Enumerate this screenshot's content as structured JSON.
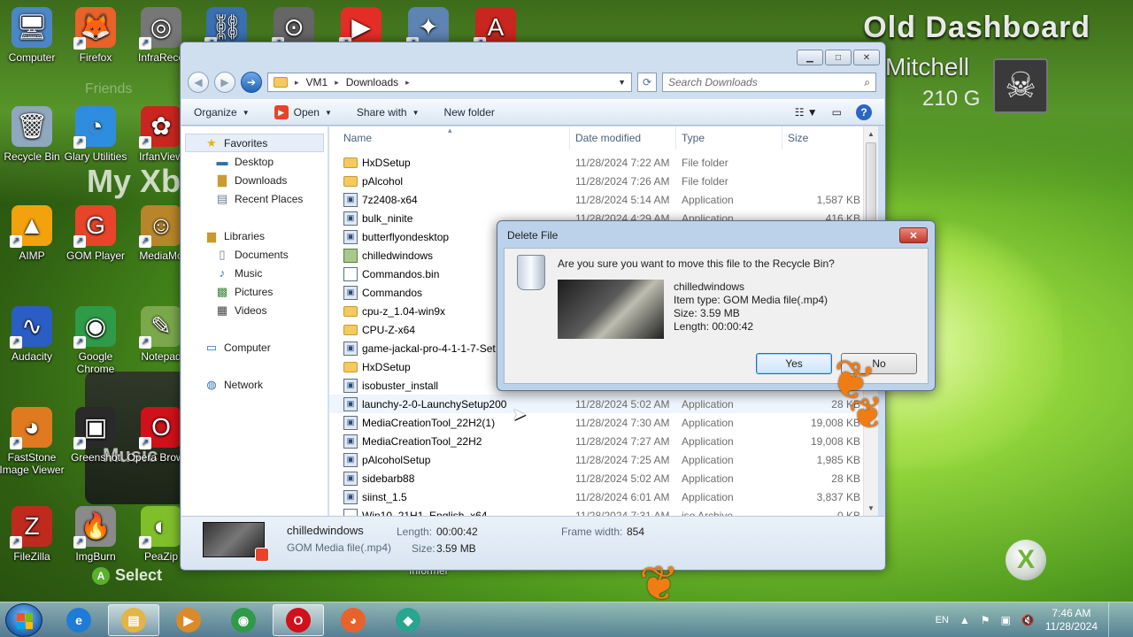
{
  "wallpaper": {
    "heading": "Old Dashboard",
    "gamer_name": "Mitchell",
    "gamer_score": "210 G",
    "faded_friends": "Friends",
    "faded_myx": "My Xb",
    "faded_music": "Music",
    "select_hint": "Select",
    "select_button": "A",
    "informer": "Informer"
  },
  "desktop_icons": [
    {
      "label": "Computer",
      "icon": "computer-icon",
      "glyph": "🖥",
      "color": "#4d86c6",
      "arrow": false
    },
    {
      "label": "Firefox",
      "icon": "firefox-icon",
      "glyph": "🦊",
      "color": "#e8622b",
      "arrow": true
    },
    {
      "label": "InfraReco",
      "icon": "infrarecorder-icon",
      "glyph": "◎",
      "color": "#777",
      "arrow": true
    },
    {
      "label": "",
      "icon": "network-tool-icon",
      "glyph": "⛓",
      "color": "#3a6fb0",
      "arrow": true
    },
    {
      "label": "",
      "icon": "disc-tool-icon",
      "glyph": "⊙",
      "color": "#666",
      "arrow": true
    },
    {
      "label": "",
      "icon": "youtube-icon",
      "glyph": "▶",
      "color": "#e52d27",
      "arrow": true
    },
    {
      "label": "",
      "icon": "satellite-icon",
      "glyph": "✦",
      "color": "#5d84b3",
      "arrow": true
    },
    {
      "label": "",
      "icon": "adobe-reader-icon",
      "glyph": "A",
      "color": "#c8261f",
      "arrow": true
    },
    {
      "label": "Recycle Bin",
      "icon": "recycle-bin-icon",
      "glyph": "🗑",
      "color": "#8fa7bf",
      "arrow": false
    },
    {
      "label": "Glary Utilities",
      "icon": "glary-utilities-icon",
      "glyph": "◔",
      "color": "#2f8de0",
      "arrow": true
    },
    {
      "label": "IrfanView",
      "icon": "irfanview-icon",
      "glyph": "✿",
      "color": "#c8261f",
      "arrow": true
    },
    {
      "label": "AIMP",
      "icon": "aimp-icon",
      "glyph": "▲",
      "color": "#f2a20c",
      "arrow": true
    },
    {
      "label": "GOM Player",
      "icon": "gom-player-icon",
      "glyph": "G",
      "color": "#e8442a",
      "arrow": true
    },
    {
      "label": "MediaMo",
      "icon": "mediamonkey-icon",
      "glyph": "☺",
      "color": "#b8862a",
      "arrow": true
    },
    {
      "label": "Audacity",
      "icon": "audacity-icon",
      "glyph": "∿",
      "color": "#2a5ec4",
      "arrow": true
    },
    {
      "label": "Google Chrome",
      "icon": "chrome-icon",
      "glyph": "◉",
      "color": "#2f9a48",
      "arrow": true
    },
    {
      "label": "Notepad",
      "icon": "notepad-icon",
      "glyph": "✎",
      "color": "#7aa84b",
      "arrow": true
    },
    {
      "label": "FastStone Image Viewer",
      "icon": "faststone-icon",
      "glyph": "◕",
      "color": "#e07a20",
      "arrow": true
    },
    {
      "label": "Greenshot",
      "icon": "greenshot-icon",
      "glyph": "▣",
      "color": "#2a2a2a",
      "arrow": true
    },
    {
      "label": "Opera Browse",
      "icon": "opera-icon",
      "glyph": "O",
      "color": "#d0101a",
      "arrow": true
    },
    {
      "label": "FileZilla",
      "icon": "filezilla-icon",
      "glyph": "Z",
      "color": "#bf2a1f",
      "arrow": true
    },
    {
      "label": "ImgBurn",
      "icon": "imgburn-icon",
      "glyph": "🔥",
      "color": "#8a8a8a",
      "arrow": true
    },
    {
      "label": "PeaZip",
      "icon": "peazip-icon",
      "glyph": "◐",
      "color": "#7fbf2a",
      "arrow": true
    }
  ],
  "explorer": {
    "address": {
      "crumbs": [
        "VM1",
        "Downloads"
      ]
    },
    "search_placeholder": "Search Downloads",
    "toolbar": {
      "organize": "Organize",
      "open": "Open",
      "share": "Share with",
      "new_folder": "New folder"
    },
    "nav": {
      "favorites": "Favorites",
      "desktop": "Desktop",
      "downloads": "Downloads",
      "recent": "Recent Places",
      "libraries": "Libraries",
      "documents": "Documents",
      "music": "Music",
      "pictures": "Pictures",
      "videos": "Videos",
      "computer": "Computer",
      "network": "Network"
    },
    "columns": {
      "name": "Name",
      "date": "Date modified",
      "type": "Type",
      "size": "Size"
    },
    "files": [
      {
        "name": "HxDSetup",
        "date": "11/28/2024 7:22 AM",
        "type": "File folder",
        "size": "",
        "kind": "folder"
      },
      {
        "name": "pAlcohol",
        "date": "11/28/2024 7:26 AM",
        "type": "File folder",
        "size": "",
        "kind": "folder"
      },
      {
        "name": "7z2408-x64",
        "date": "11/28/2024 5:14 AM",
        "type": "Application",
        "size": "1,587 KB",
        "kind": "app"
      },
      {
        "name": "bulk_ninite",
        "date": "11/28/2024 4:29 AM",
        "type": "Application",
        "size": "416 KB",
        "kind": "app"
      },
      {
        "name": "butterflyondesktop",
        "date": "",
        "type": "",
        "size": "",
        "kind": "app"
      },
      {
        "name": "chilledwindows",
        "date": "",
        "type": "",
        "size": "",
        "kind": "video"
      },
      {
        "name": "Commandos.bin",
        "date": "",
        "type": "",
        "size": "",
        "kind": "file"
      },
      {
        "name": "Commandos",
        "date": "",
        "type": "",
        "size": "",
        "kind": "app"
      },
      {
        "name": "cpu-z_1.04-win9x",
        "date": "",
        "type": "",
        "size": "",
        "kind": "folder"
      },
      {
        "name": "CPU-Z-x64",
        "date": "",
        "type": "",
        "size": "",
        "kind": "folder"
      },
      {
        "name": "game-jackal-pro-4-1-1-7-Set",
        "date": "",
        "type": "",
        "size": "",
        "kind": "app"
      },
      {
        "name": "HxDSetup",
        "date": "",
        "type": "",
        "size": "",
        "kind": "folder"
      },
      {
        "name": "isobuster_install",
        "date": "",
        "type": "",
        "size": "",
        "kind": "app"
      },
      {
        "name": "launchy-2-0-LaunchySetup200",
        "date": "11/28/2024 5:02 AM",
        "type": "Application",
        "size": "28 KB",
        "kind": "app"
      },
      {
        "name": "MediaCreationTool_22H2(1)",
        "date": "11/28/2024 7:30 AM",
        "type": "Application",
        "size": "19,008 KB",
        "kind": "app"
      },
      {
        "name": "MediaCreationTool_22H2",
        "date": "11/28/2024 7:27 AM",
        "type": "Application",
        "size": "19,008 KB",
        "kind": "app"
      },
      {
        "name": "pAlcoholSetup",
        "date": "11/28/2024 7:25 AM",
        "type": "Application",
        "size": "1,985 KB",
        "kind": "app"
      },
      {
        "name": "sidebarb88",
        "date": "11/28/2024 5:02 AM",
        "type": "Application",
        "size": "28 KB",
        "kind": "app"
      },
      {
        "name": "siinst_1.5",
        "date": "11/28/2024 6:01 AM",
        "type": "Application",
        "size": "3,837 KB",
        "kind": "app"
      },
      {
        "name": "Win10_21H1_English_x64",
        "date": "11/28/2024 7:31 AM",
        "type": "iso Archive",
        "size": "0 KB",
        "kind": "file"
      }
    ],
    "details": {
      "name": "chilledwindows",
      "type": "GOM Media file(.mp4)",
      "length_label": "Length:",
      "length": "00:00:42",
      "size_label": "Size:",
      "size": "3.59 MB",
      "frame_width_label": "Frame width:",
      "frame_width": "854"
    }
  },
  "dialog": {
    "title": "Delete File",
    "question": "Are you sure you want to move this file to the Recycle Bin?",
    "file_name": "chilledwindows",
    "item_type": "Item type: GOM Media file(.mp4)",
    "size": "Size: 3.59 MB",
    "length": "Length: 00:00:42",
    "yes": "Yes",
    "no": "No"
  },
  "taskbar": {
    "apps": [
      {
        "icon": "internet-explorer-icon",
        "glyph": "e",
        "color": "#1f7bd8"
      },
      {
        "icon": "windows-explorer-icon",
        "glyph": "▤",
        "color": "#e2b544",
        "active": true
      },
      {
        "icon": "media-player-icon",
        "glyph": "▶",
        "color": "#d98a2b"
      },
      {
        "icon": "chrome-icon",
        "glyph": "◉",
        "color": "#2f9a48"
      },
      {
        "icon": "opera-icon",
        "glyph": "O",
        "color": "#d0101a",
        "active": true
      },
      {
        "icon": "firefox-icon",
        "glyph": "◕",
        "color": "#e8622b"
      },
      {
        "icon": "app-icon",
        "glyph": "◆",
        "color": "#2aa58f"
      }
    ],
    "lang": "EN",
    "time": "7:46 AM",
    "date": "11/28/2024"
  }
}
